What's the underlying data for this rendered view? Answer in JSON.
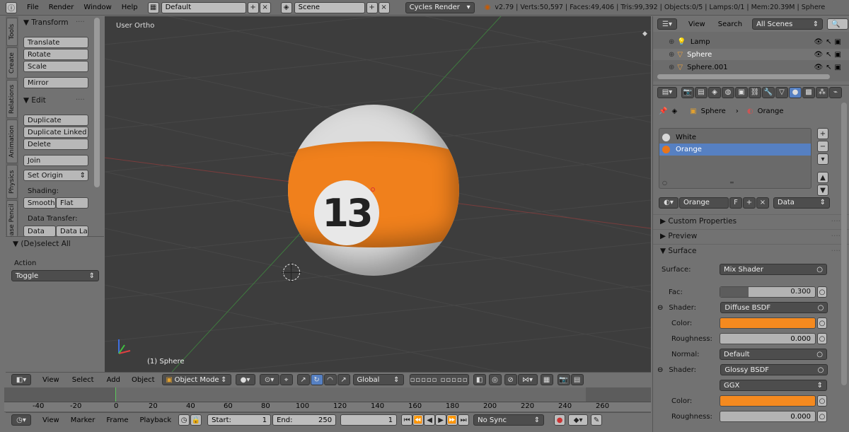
{
  "topbar": {
    "menus": [
      "File",
      "Render",
      "Window",
      "Help"
    ],
    "layout": "Default",
    "scene": "Scene",
    "engine": "Cycles Render",
    "stats": "v2.79 | Verts:50,597 | Faces:49,406 | Tris:99,392 | Objects:0/5 | Lamps:0/1 | Mem:20.39M | Sphere"
  },
  "vtabs": [
    "Tools",
    "Create",
    "Relations",
    "Animation",
    "Physics",
    "Grease Pencil"
  ],
  "tools": {
    "transform_title": "Transform",
    "translate": "Translate",
    "rotate": "Rotate",
    "scale": "Scale",
    "mirror": "Mirror",
    "edit_title": "Edit",
    "duplicate": "Duplicate",
    "duplicate_linked": "Duplicate Linked",
    "delete": "Delete",
    "join": "Join",
    "set_origin": "Set Origin",
    "shading_label": "Shading:",
    "smooth": "Smooth",
    "flat": "Flat",
    "data_transfer_label": "Data Transfer:",
    "data": "Data",
    "data_layout": "Data La",
    "deselect_title": "(De)select All",
    "action_label": "Action",
    "action_value": "Toggle"
  },
  "viewport": {
    "view_name": "User Ortho",
    "object_label": "(1) Sphere",
    "ball_number": "13"
  },
  "viewport_header": {
    "view": "View",
    "select": "Select",
    "add": "Add",
    "object": "Object",
    "mode": "Object Mode",
    "orientation": "Global"
  },
  "timeline": {
    "ruler": [
      "-40",
      "-20",
      "0",
      "20",
      "40",
      "60",
      "80",
      "100",
      "120",
      "140",
      "160",
      "180",
      "200",
      "220",
      "240",
      "260"
    ],
    "view": "View",
    "marker": "Marker",
    "frame": "Frame",
    "playback": "Playback",
    "start_label": "Start:",
    "start_value": "1",
    "end_label": "End:",
    "end_value": "250",
    "current": "1",
    "sync": "No Sync"
  },
  "outliner": {
    "view": "View",
    "search": "Search",
    "scenes": "All Scenes",
    "items": [
      "Lamp",
      "Sphere",
      "Sphere.001"
    ]
  },
  "properties": {
    "crumb_object": "Sphere",
    "crumb_material": "Orange",
    "slots": [
      "White",
      "Orange"
    ],
    "slot_colors": [
      "#d8d8d8",
      "#e8751a"
    ],
    "material_name": "Orange",
    "fake_user": "F",
    "link": "Data",
    "custom_props": "Custom Properties",
    "preview": "Preview",
    "surface": "Surface",
    "surface_label": "Surface:",
    "surface_value": "Mix Shader",
    "fac_label": "Fac:",
    "fac_value": "0.300",
    "fac": 0.3,
    "shader1_label": "Shader:",
    "shader1_value": "Diffuse BSDF",
    "color_label": "Color:",
    "color_value": "#f58a1f",
    "roughness_label": "Roughness:",
    "roughness1_value": "0.000",
    "normal_label": "Normal:",
    "normal_value": "Default",
    "shader2_label": "Shader:",
    "shader2_value": "Glossy BSDF",
    "distribution": "GGX",
    "color2_label": "Color:",
    "roughness2_label": "Roughness:",
    "roughness2_value": "0.000"
  }
}
